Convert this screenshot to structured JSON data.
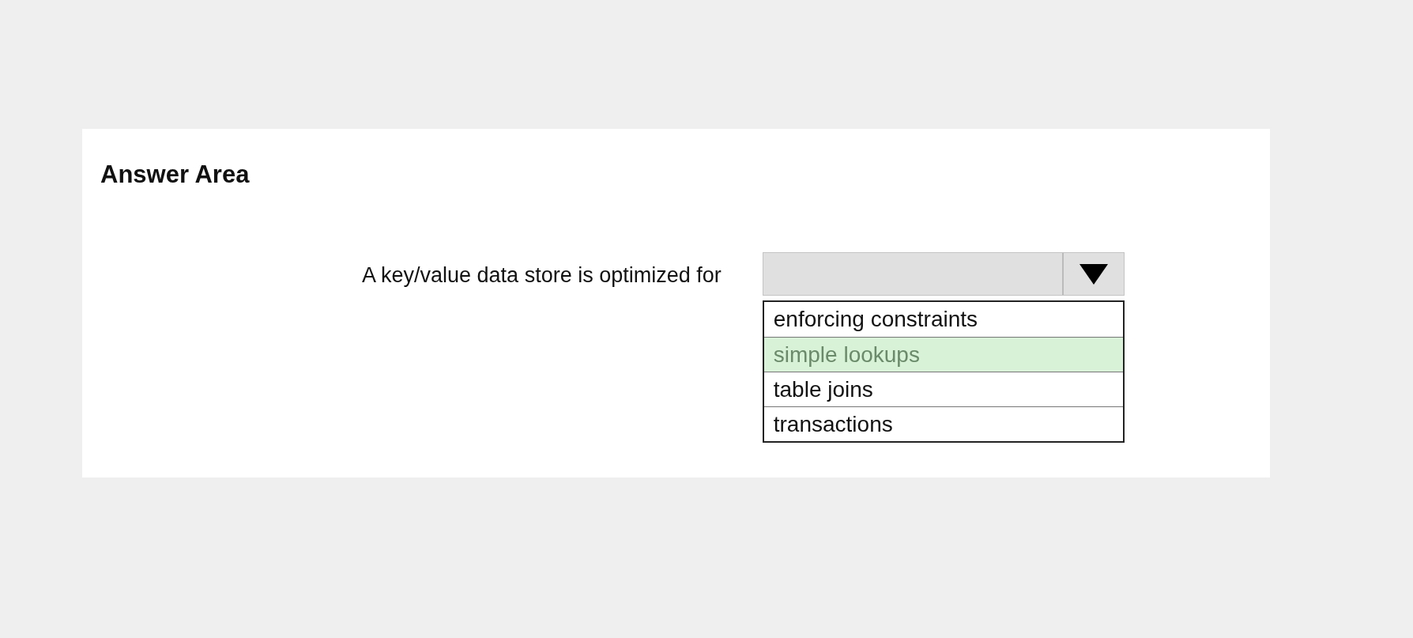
{
  "panel": {
    "title": "Answer Area"
  },
  "question": {
    "text": "A key/value data store is optimized for",
    "dropdown": {
      "expanded": true,
      "options": [
        {
          "label": "enforcing constraints",
          "selected": false
        },
        {
          "label": "simple lookups",
          "selected": true
        },
        {
          "label": "table joins",
          "selected": false
        },
        {
          "label": "transactions",
          "selected": false
        }
      ]
    }
  }
}
